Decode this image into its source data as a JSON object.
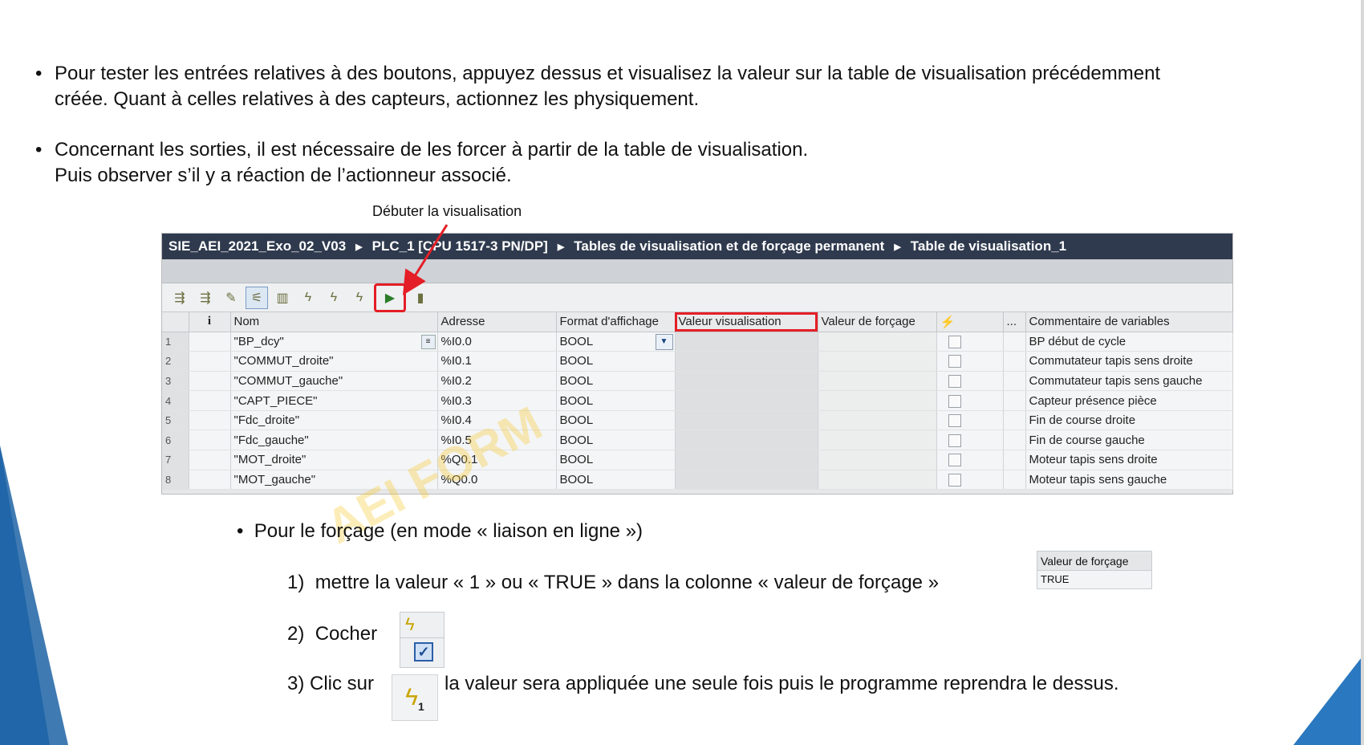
{
  "bullets": [
    {
      "line1": "Pour tester les entrées relatives à des boutons, appuyez dessus et visualisez la valeur sur la table de visualisation précédemment",
      "line2": "créée. Quant à celles relatives à des capteurs, actionnez les physiquement."
    },
    {
      "line1": "Concernant les sorties, il est nécessaire de les forcer à partir de la table de visualisation.",
      "line2": "Puis observer s’il y a réaction de l’actionneur associé."
    }
  ],
  "callout": "Débuter la visualisation",
  "tia": {
    "path": [
      "SIE_AEI_2021_Exo_02_V03",
      "PLC_1 [CPU 1517-3 PN/DP]",
      "Tables de visualisation et de forçage permanent",
      "Table de visualisation_1"
    ],
    "columns": [
      "",
      "i",
      "Nom",
      "Adresse",
      "Format d'affichage",
      "Valeur visualisation",
      "Valeur de forçage",
      "⚡",
      "...",
      "Commentaire de variables"
    ],
    "rows": [
      {
        "num": "1",
        "name": "\"BP_dcy\"",
        "addr": "%I0.0",
        "fmt": "BOOL",
        "comment": "BP début de cycle"
      },
      {
        "num": "2",
        "name": "\"COMMUT_droite\"",
        "addr": "%I0.1",
        "fmt": "BOOL",
        "comment": "Commutateur tapis sens droite"
      },
      {
        "num": "3",
        "name": "\"COMMUT_gauche\"",
        "addr": "%I0.2",
        "fmt": "BOOL",
        "comment": "Commutateur tapis sens gauche"
      },
      {
        "num": "4",
        "name": "\"CAPT_PIECE\"",
        "addr": "%I0.3",
        "fmt": "BOOL",
        "comment": "Capteur présence pièce"
      },
      {
        "num": "5",
        "name": "\"Fdc_droite\"",
        "addr": "%I0.4",
        "fmt": "BOOL",
        "comment": "Fin de course droite"
      },
      {
        "num": "6",
        "name": "\"Fdc_gauche\"",
        "addr": "%I0.5",
        "fmt": "BOOL",
        "comment": "Fin de course gauche"
      },
      {
        "num": "7",
        "name": "\"MOT_droite\"",
        "addr": "%Q0.1",
        "fmt": "BOOL",
        "comment": "Moteur tapis sens droite"
      },
      {
        "num": "8",
        "name": "\"MOT_gauche\"",
        "addr": "%Q0.0",
        "fmt": "BOOL",
        "comment": "Moteur tapis sens gauche"
      }
    ]
  },
  "watermark": "AEI FORM",
  "sub_bullet": "Pour le forçage (en mode « liaison en ligne »)",
  "steps": [
    {
      "num": "1)",
      "text": "mettre la valeur « 1  » ou « TRUE » dans la colonne « valeur de forçage »"
    },
    {
      "num": "2)",
      "text": "Cocher"
    },
    {
      "num": "3)",
      "text": "Clic sur"
    },
    {
      "text": "la valeur sera appliquée une seule fois puis le programme reprendra le dessus."
    }
  ],
  "force_box": {
    "header": "Valeur de forçage",
    "value": "TRUE"
  },
  "icons": {
    "force_once_sub": "1",
    "check": "✓"
  },
  "colors": {
    "highlight": "#e41e26",
    "path_bar": "#2f3a4e",
    "accent_blue": "#2a78bf"
  }
}
